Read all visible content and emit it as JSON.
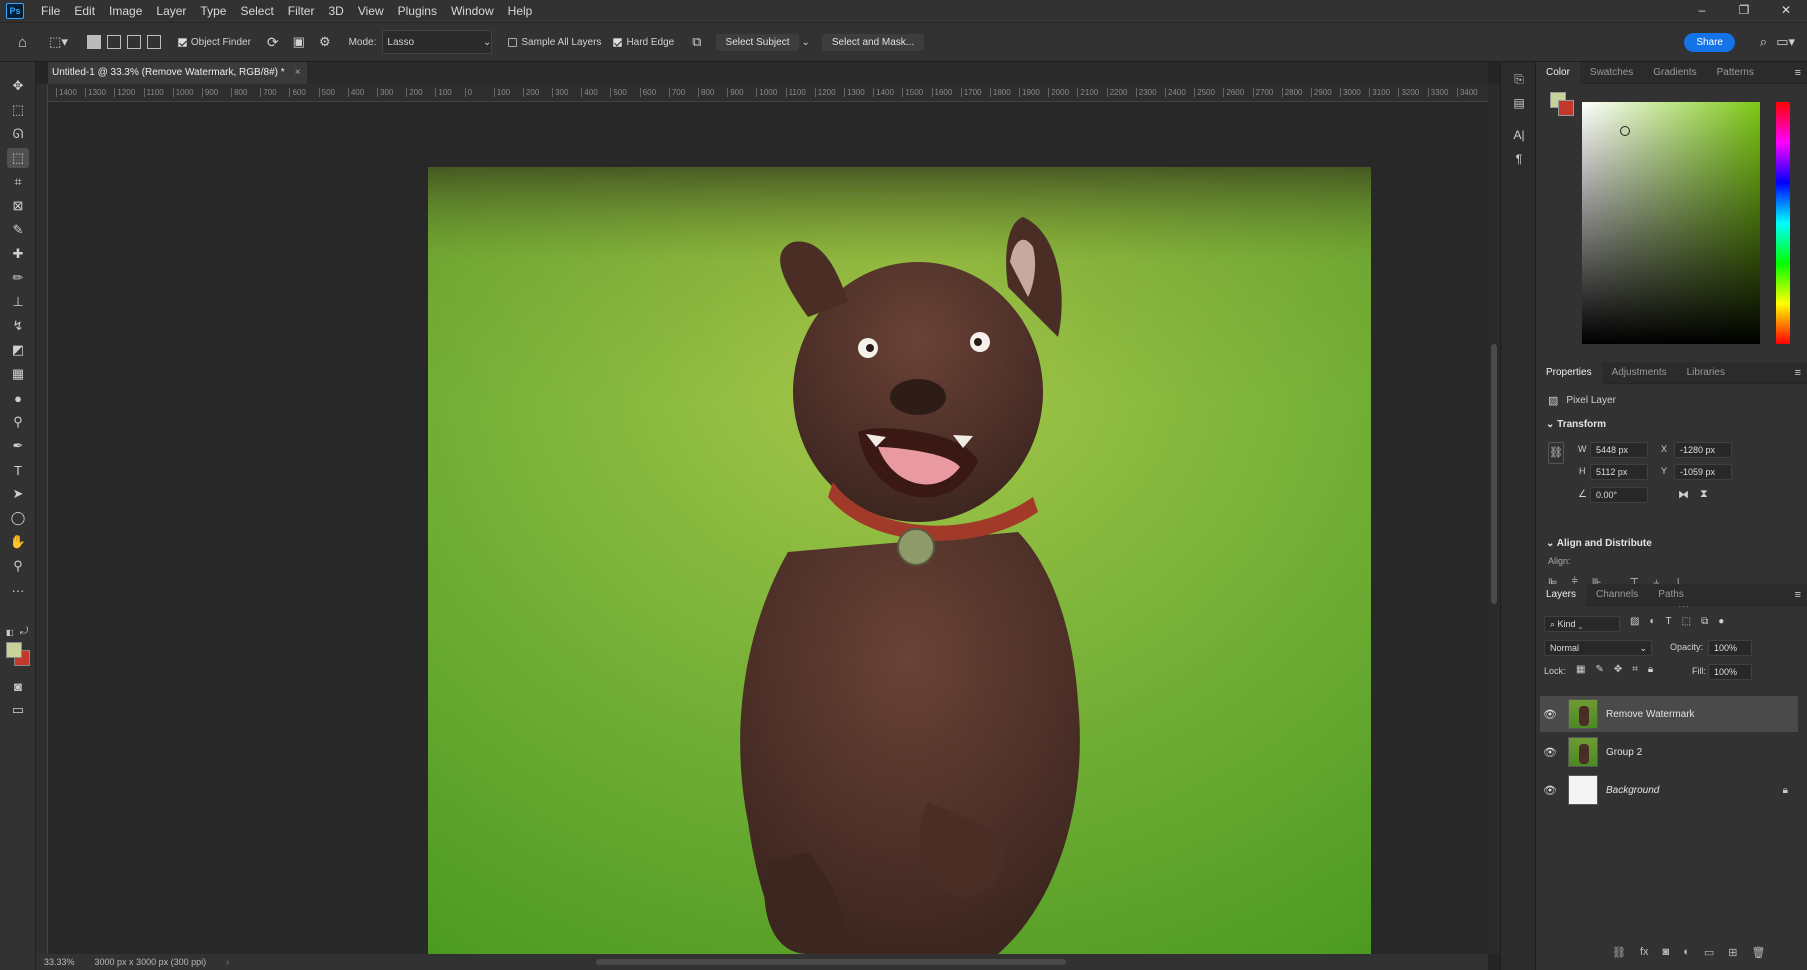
{
  "menu": {
    "app_icon": "Ps",
    "items": [
      "File",
      "Edit",
      "Image",
      "Layer",
      "Type",
      "Select",
      "Filter",
      "3D",
      "View",
      "Plugins",
      "Window",
      "Help"
    ]
  },
  "window_controls": {
    "minimize": "–",
    "restore": "❐",
    "close": "✕"
  },
  "options": {
    "object_finder": "Object Finder",
    "mode_label": "Mode:",
    "mode_value": "Lasso",
    "sample_all_layers": "Sample All Layers",
    "hard_edge": "Hard Edge",
    "select_subject": "Select Subject",
    "select_and_mask": "Select and Mask...",
    "share": "Share"
  },
  "document": {
    "tab_title": "Untitled-1 @ 33.3% (Remove Watermark, RGB/8#) *",
    "close": "×"
  },
  "ruler": {
    "ticks": [
      "1400",
      "1300",
      "1200",
      "1100",
      "1000",
      "900",
      "800",
      "700",
      "600",
      "500",
      "400",
      "300",
      "200",
      "100",
      "0",
      "100",
      "200",
      "300",
      "400",
      "500",
      "600",
      "700",
      "800",
      "900",
      "1000",
      "1100",
      "1200",
      "1300",
      "1400",
      "1500",
      "1600",
      "1700",
      "1800",
      "1900",
      "2000",
      "2100",
      "2200",
      "2300",
      "2400",
      "2500",
      "2600",
      "2700",
      "2800",
      "2900",
      "3000",
      "3100",
      "3200",
      "3300",
      "3400"
    ]
  },
  "status": {
    "zoom": "33.33%",
    "doc_size": "3000 px x 3000 px (300 ppi)"
  },
  "color_panel": {
    "tabs": [
      "Color",
      "Swatches",
      "Gradients",
      "Patterns"
    ],
    "foreground": "#c8d29a",
    "background": "#c0392b"
  },
  "properties_panel": {
    "tabs": [
      "Properties",
      "Adjustments",
      "Libraries"
    ],
    "layer_kind": "Pixel Layer",
    "transform_label": "Transform",
    "w_label": "W",
    "w": "5448 px",
    "h_label": "H",
    "h": "5112 px",
    "x_label": "X",
    "x": "-1280 px",
    "y_label": "Y",
    "y": "-1059 px",
    "angle": "0.00°",
    "align_label": "Align and Distribute",
    "align_sub": "Align:",
    "more": "···"
  },
  "layers_panel": {
    "tabs": [
      "Layers",
      "Channels",
      "Paths"
    ],
    "kind": "Kind",
    "blend": "Normal",
    "opacity_label": "Opacity:",
    "opacity": "100%",
    "lock_label": "Lock:",
    "fill_label": "Fill:",
    "fill": "100%",
    "layers": [
      {
        "name": "Remove Watermark",
        "selected": true
      },
      {
        "name": "Group 2",
        "selected": false
      },
      {
        "name": "Background",
        "selected": false
      }
    ]
  },
  "colors": {
    "accent": "#1473e6",
    "panel": "#323232",
    "grass": "#5fa02a"
  }
}
